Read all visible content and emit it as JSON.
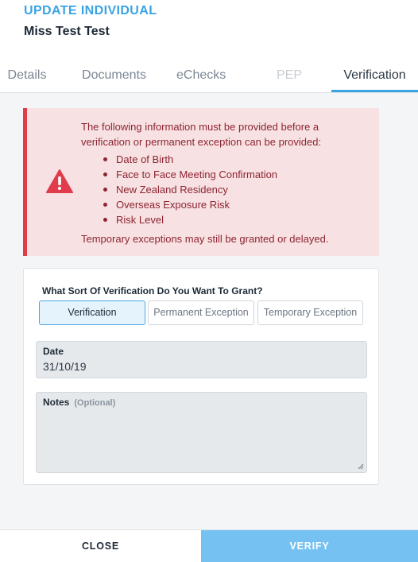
{
  "header": {
    "label": "UPDATE INDIVIDUAL",
    "name": "Miss Test Test"
  },
  "tabs": [
    {
      "label": "Details",
      "state": "normal"
    },
    {
      "label": "Documents",
      "state": "normal"
    },
    {
      "label": "eChecks",
      "state": "normal"
    },
    {
      "label": "PEP",
      "state": "disabled"
    },
    {
      "label": "Verification",
      "state": "active"
    }
  ],
  "alert": {
    "icon": "warning-triangle-icon",
    "intro": "The following information must be provided before a verification or permanent exception can be provided:",
    "items": [
      "Date of Birth",
      "Face to Face Meeting Confirmation",
      "New Zealand Residency",
      "Overseas Exposure Risk",
      "Risk Level"
    ],
    "footer": "Temporary exceptions may still be granted or delayed."
  },
  "form": {
    "question": "What Sort Of Verification Do You Want To Grant?",
    "options": [
      {
        "label": "Verification",
        "selected": true
      },
      {
        "label": "Permanent Exception",
        "selected": false
      },
      {
        "label": "Temporary Exception",
        "selected": false
      }
    ],
    "date": {
      "label": "Date",
      "value": "31/10/19"
    },
    "notes": {
      "label": "Notes",
      "optional": "(Optional)",
      "value": ""
    }
  },
  "footer": {
    "close_label": "CLOSE",
    "verify_label": "VERIFY"
  },
  "colors": {
    "accent": "#3aa3e3",
    "alert_border": "#e03c4c",
    "alert_bg": "#f7e1e3",
    "verify_bg": "#74c1f2"
  }
}
